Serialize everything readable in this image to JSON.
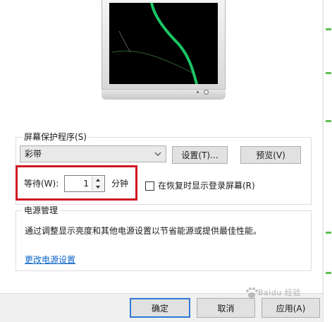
{
  "screensaver": {
    "group_label": "屏幕保护程序(S)",
    "selected": "彩带",
    "settings_button": "设置(T)...",
    "preview_button": "预览(V)",
    "wait_label": "等待(W):",
    "wait_value": "1",
    "minutes_label": "分钟",
    "resume_checkbox_label": "在恢复时显示登录屏幕(R)",
    "resume_checked": false
  },
  "power": {
    "group_label": "电源管理",
    "description": "通过调整显示亮度和其他电源设置以节省能源或提供最佳性能。",
    "link": "更改电源设置"
  },
  "footer": {
    "ok": "确定",
    "cancel": "取消",
    "apply": "应用(A)"
  },
  "preview": {
    "ribbon_color": "#19c564",
    "ribbon_faint_color": "#2f6b33"
  },
  "annotation": {
    "highlight_color": "#d01722"
  },
  "watermark": {
    "text": "Baidu 经验"
  },
  "icons": {
    "dropdown": "chevron-down-icon",
    "spin_up": "triangle-up-icon",
    "spin_down": "triangle-down-icon",
    "watermark": "paw-icon"
  }
}
